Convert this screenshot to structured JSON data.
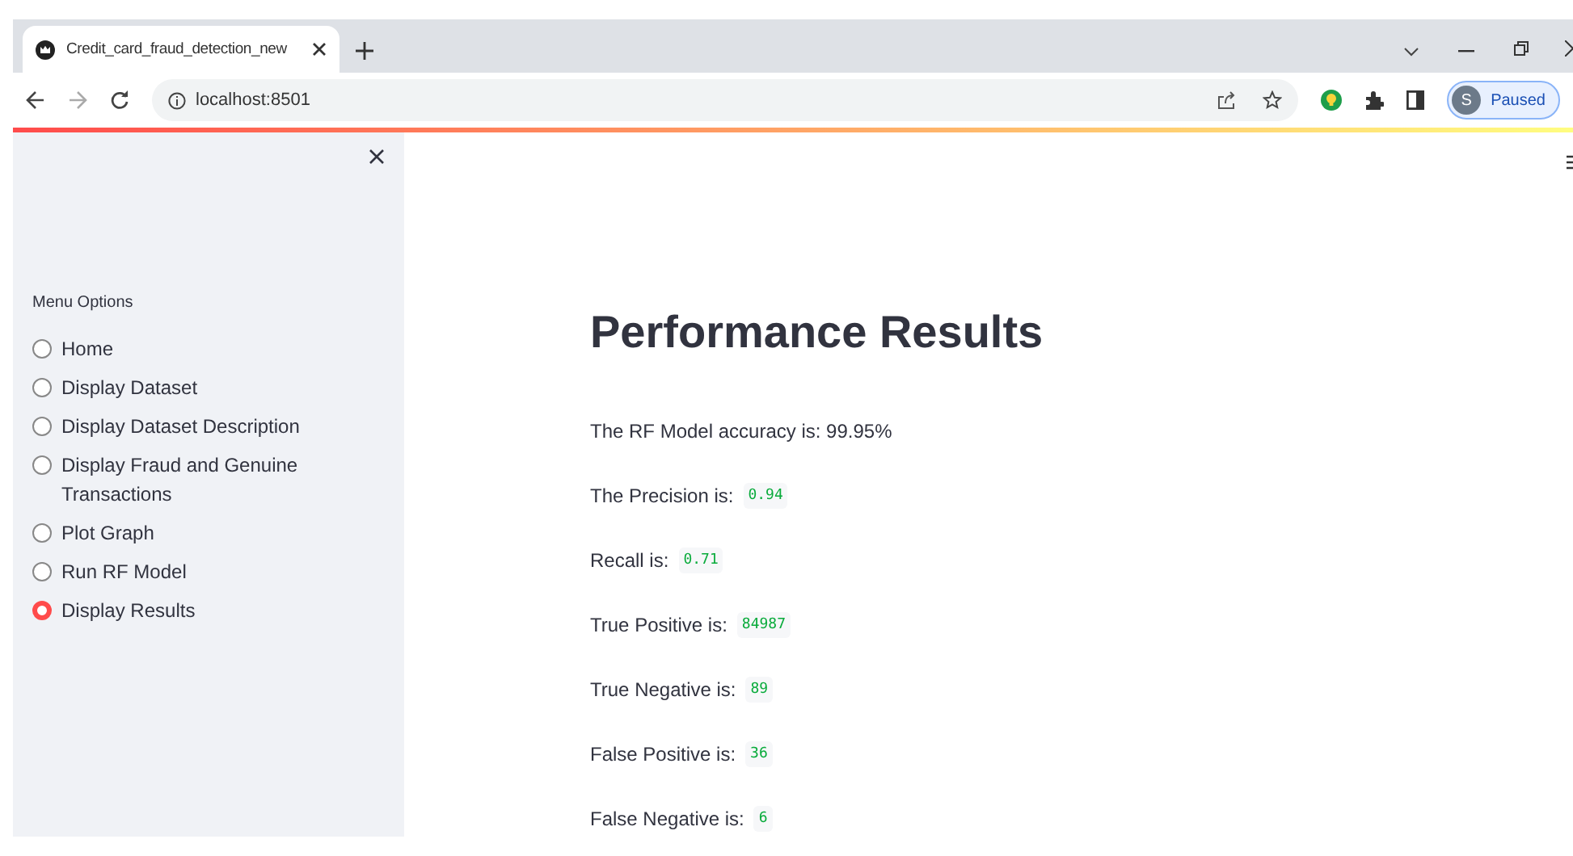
{
  "browser": {
    "tab_title": "Credit_card_fraud_detection_new",
    "url": "localhost:8501",
    "profile": {
      "initial": "S",
      "status": "Paused"
    }
  },
  "sidebar": {
    "heading": "Menu Options",
    "options": [
      {
        "label": "Home",
        "selected": false
      },
      {
        "label": "Display Dataset",
        "selected": false
      },
      {
        "label": "Display Dataset Description",
        "selected": false
      },
      {
        "label": "Display Fraud and Genuine Transactions",
        "selected": false
      },
      {
        "label": "Plot Graph",
        "selected": false
      },
      {
        "label": "Run RF Model",
        "selected": false
      },
      {
        "label": "Display Results",
        "selected": true
      }
    ]
  },
  "main": {
    "title": "Performance Results",
    "results": [
      {
        "kind": "text",
        "label": "The RF Model accuracy is: 99.95%"
      },
      {
        "kind": "code",
        "label": "The Precision is:",
        "value": "0.94"
      },
      {
        "kind": "code",
        "label": "Recall is:",
        "value": "0.71"
      },
      {
        "kind": "code",
        "label": "True Positive is:",
        "value": "84987"
      },
      {
        "kind": "code",
        "label": "True Negative is:",
        "value": "89"
      },
      {
        "kind": "code",
        "label": "False Positive is:",
        "value": "36"
      },
      {
        "kind": "code",
        "label": "False Negative is:",
        "value": "6"
      }
    ]
  }
}
